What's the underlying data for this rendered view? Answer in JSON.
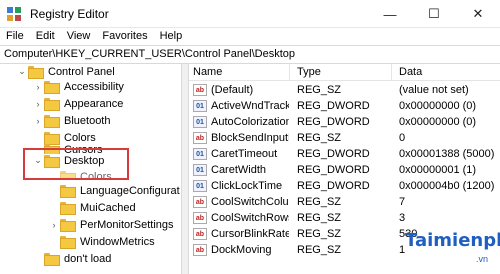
{
  "window": {
    "title": "Registry Editor",
    "minimize_glyph": "—",
    "maximize_glyph": "☐",
    "close_glyph": "✕"
  },
  "menu": [
    "File",
    "Edit",
    "View",
    "Favorites",
    "Help"
  ],
  "address": "Computer\\HKEY_CURRENT_USER\\Control Panel\\Desktop",
  "tree": [
    {
      "label": "Control Panel",
      "indent": 1,
      "chevron": "⌄"
    },
    {
      "label": "Accessibility",
      "indent": 2,
      "chevron": "›"
    },
    {
      "label": "Appearance",
      "indent": 2,
      "chevron": "›"
    },
    {
      "label": "Bluetooth",
      "indent": 2,
      "chevron": "›"
    },
    {
      "label": "Colors",
      "indent": 2,
      "chevron": ""
    },
    {
      "label": "Cursors",
      "indent": 2,
      "chevron": ""
    },
    {
      "label": "Desktop",
      "indent": 2,
      "chevron": "⌄",
      "selected": true
    },
    {
      "label": "Colors",
      "indent": 3,
      "chevron": ""
    },
    {
      "label": "LanguageConfigurati",
      "indent": 3,
      "chevron": ""
    },
    {
      "label": "MuiCached",
      "indent": 3,
      "chevron": ""
    },
    {
      "label": "PerMonitorSettings",
      "indent": 3,
      "chevron": "›"
    },
    {
      "label": "WindowMetrics",
      "indent": 3,
      "chevron": ""
    },
    {
      "label": "don't load",
      "indent": 2,
      "chevron": ""
    }
  ],
  "columns": {
    "name": "Name",
    "type": "Type",
    "data": "Data"
  },
  "values": [
    {
      "icon": "ab",
      "name": "(Default)",
      "type": "REG_SZ",
      "data": "(value not set)"
    },
    {
      "icon": "dw",
      "name": "ActiveWndTrack...",
      "type": "REG_DWORD",
      "data": "0x00000000 (0)"
    },
    {
      "icon": "dw",
      "name": "AutoColorization",
      "type": "REG_DWORD",
      "data": "0x00000000 (0)"
    },
    {
      "icon": "ab",
      "name": "BlockSendInputR...",
      "type": "REG_SZ",
      "data": "0"
    },
    {
      "icon": "dw",
      "name": "CaretTimeout",
      "type": "REG_DWORD",
      "data": "0x00001388 (5000)"
    },
    {
      "icon": "dw",
      "name": "CaretWidth",
      "type": "REG_DWORD",
      "data": "0x00000001 (1)"
    },
    {
      "icon": "dw",
      "name": "ClickLockTime",
      "type": "REG_DWORD",
      "data": "0x000004b0 (1200)"
    },
    {
      "icon": "ab",
      "name": "CoolSwitchColu",
      "type": "REG_SZ",
      "data": "7"
    },
    {
      "icon": "ab",
      "name": "CoolSwitchRows",
      "type": "REG_SZ",
      "data": "3"
    },
    {
      "icon": "ab",
      "name": "CursorBlinkRate",
      "type": "REG_SZ",
      "data": "530"
    },
    {
      "icon": "dw",
      "name": "DockMoving",
      "type": "REG_SZ",
      "data": "1"
    }
  ],
  "watermark": {
    "logo": "Taimienphi",
    "suffix": ".vn"
  }
}
